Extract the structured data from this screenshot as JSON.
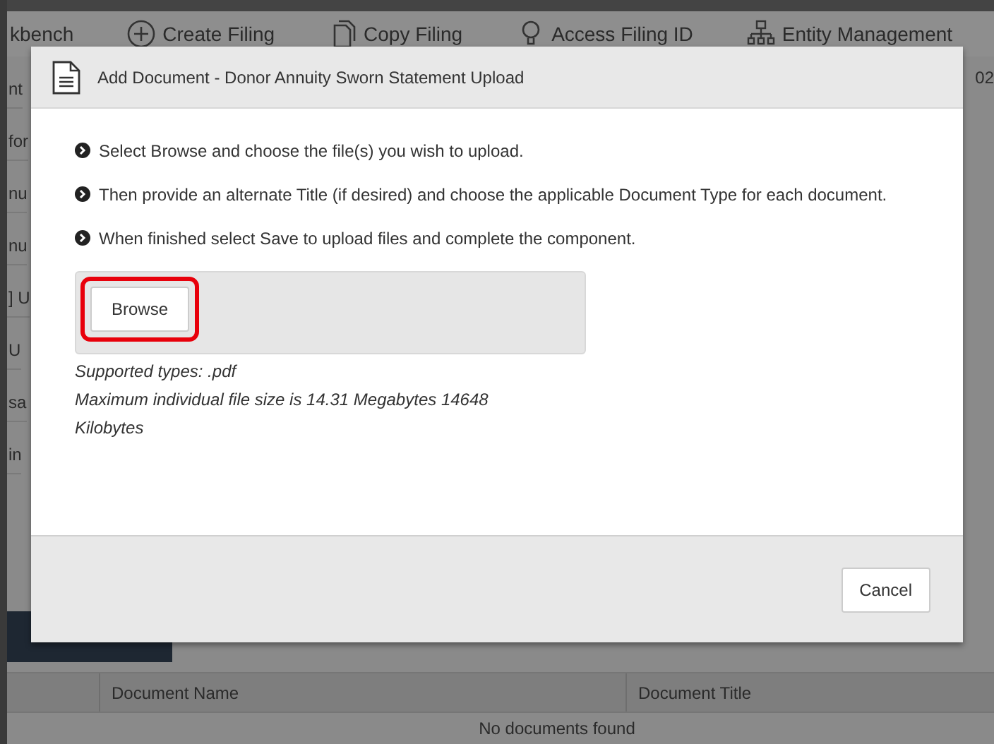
{
  "background_page": {
    "nav_items": [
      {
        "label": "kbench",
        "kind": "plain"
      },
      {
        "label": "Create Filing",
        "kind": "create"
      },
      {
        "label": "Copy Filing",
        "kind": "copy"
      },
      {
        "label": "Access Filing ID",
        "kind": "access"
      },
      {
        "label": "Entity Management",
        "kind": "entity"
      }
    ],
    "corner_text": "02",
    "side_fragments": [
      "nt",
      "for",
      "nu",
      "nu",
      "] U",
      "U",
      "sa",
      "in"
    ],
    "table": {
      "columns": [
        "Document Name",
        "Document Title"
      ],
      "empty_message": "No documents found"
    }
  },
  "dialog": {
    "title": "Add Document - Donor Annuity Sworn Statement Upload",
    "instructions": [
      "Select Browse and choose the file(s) you wish to upload.",
      "Then provide an alternate Title (if desired) and choose the applicable Document Type for each document.",
      "When finished select Save to upload files and complete the component."
    ],
    "browse_button": "Browse",
    "browse_highlighted": true,
    "supported_types": "Supported types: .pdf",
    "max_size": "Maximum individual file size is 14.31 Megabytes 14648 Kilobytes",
    "buttons": [
      "Cancel"
    ]
  }
}
